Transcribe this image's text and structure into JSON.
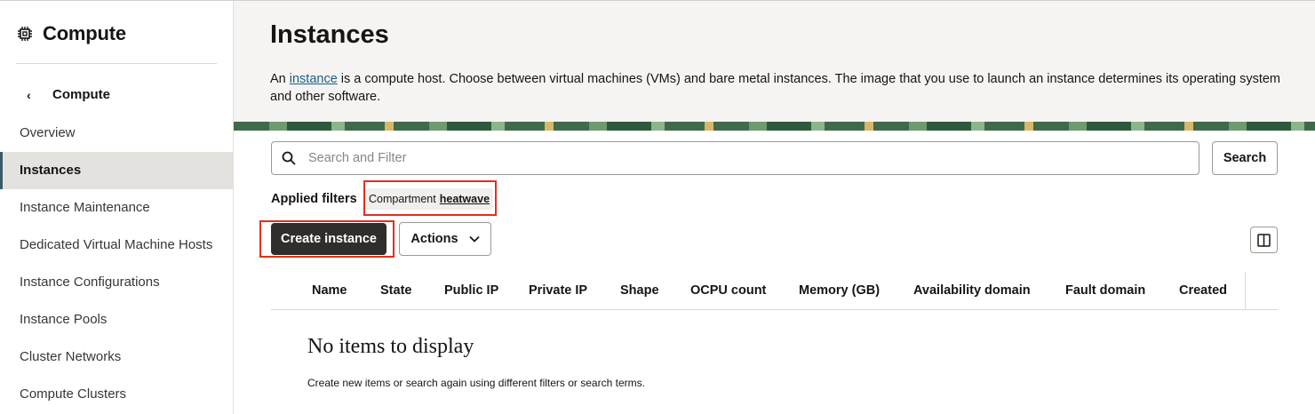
{
  "sidebar": {
    "title": "Compute",
    "back_label": "Compute",
    "items": [
      {
        "label": "Overview",
        "active": false
      },
      {
        "label": "Instances",
        "active": true
      },
      {
        "label": "Instance Maintenance",
        "active": false
      },
      {
        "label": "Dedicated Virtual Machine Hosts",
        "active": false
      },
      {
        "label": "Instance Configurations",
        "active": false
      },
      {
        "label": "Instance Pools",
        "active": false
      },
      {
        "label": "Cluster Networks",
        "active": false
      },
      {
        "label": "Compute Clusters",
        "active": false
      }
    ]
  },
  "main": {
    "title": "Instances",
    "description_prefix": "An ",
    "description_link": "instance",
    "description_suffix": " is a compute host. Choose between virtual machines (VMs) and bare metal instances. The image that you use to launch an instance determines its operating system and other software.",
    "search": {
      "placeholder": "Search and Filter",
      "value": "",
      "button_label": "Search"
    },
    "filters": {
      "label": "Applied filters",
      "chip_key": "Compartment",
      "chip_value": "heatwave"
    },
    "create_label": "Create instance",
    "actions_label": "Actions",
    "table": {
      "columns": [
        "Name",
        "State",
        "Public IP",
        "Private IP",
        "Shape",
        "OCPU count",
        "Memory (GB)",
        "Availability domain",
        "Fault domain",
        "Created"
      ],
      "rows": []
    },
    "empty": {
      "title": "No items to display",
      "text": "Create new items or search again using different filters or search terms."
    }
  },
  "colors": {
    "primary_button": "#312d2a",
    "active_nav_bg": "#e4e2df",
    "highlight_box": "#e0301e",
    "link": "#1b5e83",
    "header_bg": "#f5f4f2"
  }
}
